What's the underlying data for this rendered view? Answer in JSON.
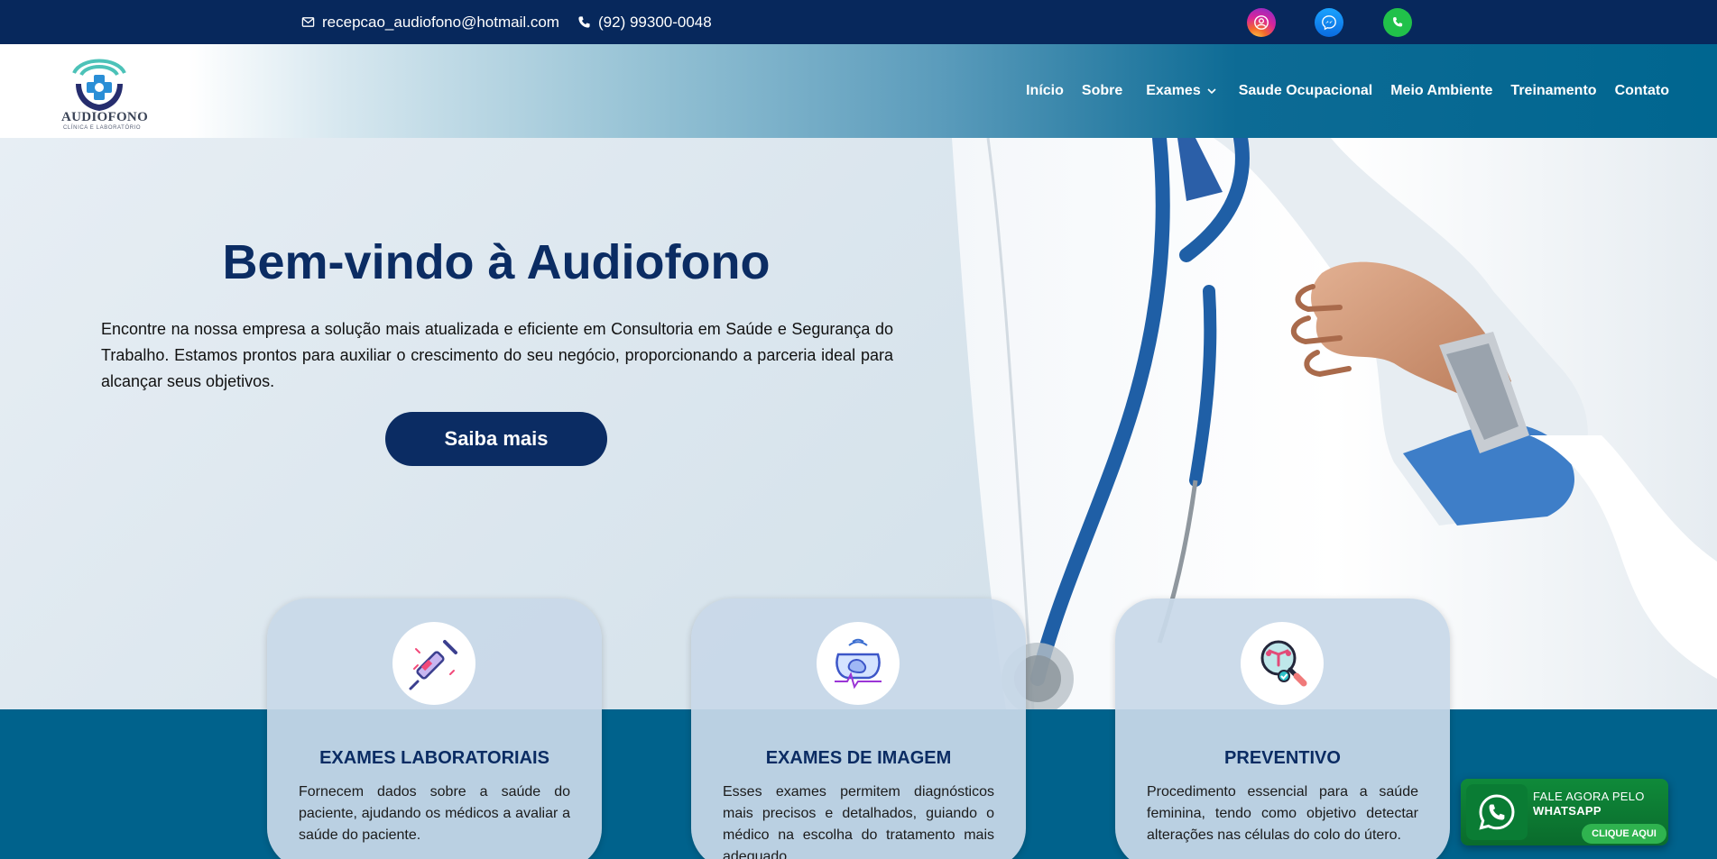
{
  "topbar": {
    "email": "recepcao_audiofono@hotmail.com",
    "phone": "(92) 99300-0048",
    "email_icon": "mail-icon",
    "phone_icon": "phone-icon",
    "social": [
      {
        "name": "instagram-icon",
        "color": "#d8249b"
      },
      {
        "name": "messenger-icon",
        "color": "#0a6be0"
      },
      {
        "name": "whatsapp-icon",
        "color": "#21c14a"
      }
    ]
  },
  "header": {
    "logo_text": "AUDIOFONO",
    "logo_subtitle": "CLÍNICA E LABORATÓRIO",
    "nav": [
      {
        "label": "Início"
      },
      {
        "label": "Sobre"
      },
      {
        "label": "Exames",
        "has_dropdown": true
      },
      {
        "label": "Saude Ocupacional"
      },
      {
        "label": "Meio Ambiente"
      },
      {
        "label": "Treinamento"
      },
      {
        "label": "Contato"
      }
    ]
  },
  "hero": {
    "title": "Bem-vindo à Audiofono",
    "text": "Encontre na nossa empresa a solução mais atualizada e eficiente em Consultoria em Saúde e Segurança do Trabalho. Estamos prontos para auxiliar o crescimento do seu negócio, proporcionando a parceria ideal para alcançar seus objetivos.",
    "button": "Saiba mais"
  },
  "cards": [
    {
      "icon": "syringe-icon",
      "title": "EXAMES LABORATORIAIS",
      "text": "Fornecem dados sobre a saúde do paciente, ajudando os médicos a avaliar a saúde do paciente."
    },
    {
      "icon": "ultrasound-icon",
      "title": "EXAMES DE IMAGEM",
      "text": "Esses exames permitem diagnósticos mais precisos e detalhados, guiando o médico na escolha do tratamento mais adequado."
    },
    {
      "icon": "uterus-magnifier-icon",
      "title": "PREVENTIVO",
      "text": "Procedimento essencial para a saúde feminina, tendo como objetivo detectar alterações nas células do colo do útero."
    }
  ],
  "whatsapp_widget": {
    "line1": "FALE AGORA PELO",
    "line2": "WHATSAPP",
    "cta": "CLIQUE AQUI"
  },
  "colors": {
    "navy": "#07285c",
    "title_navy": "#0b2c63",
    "teal_band": "#00628c",
    "whatsapp_green": "#0f8a3a"
  }
}
